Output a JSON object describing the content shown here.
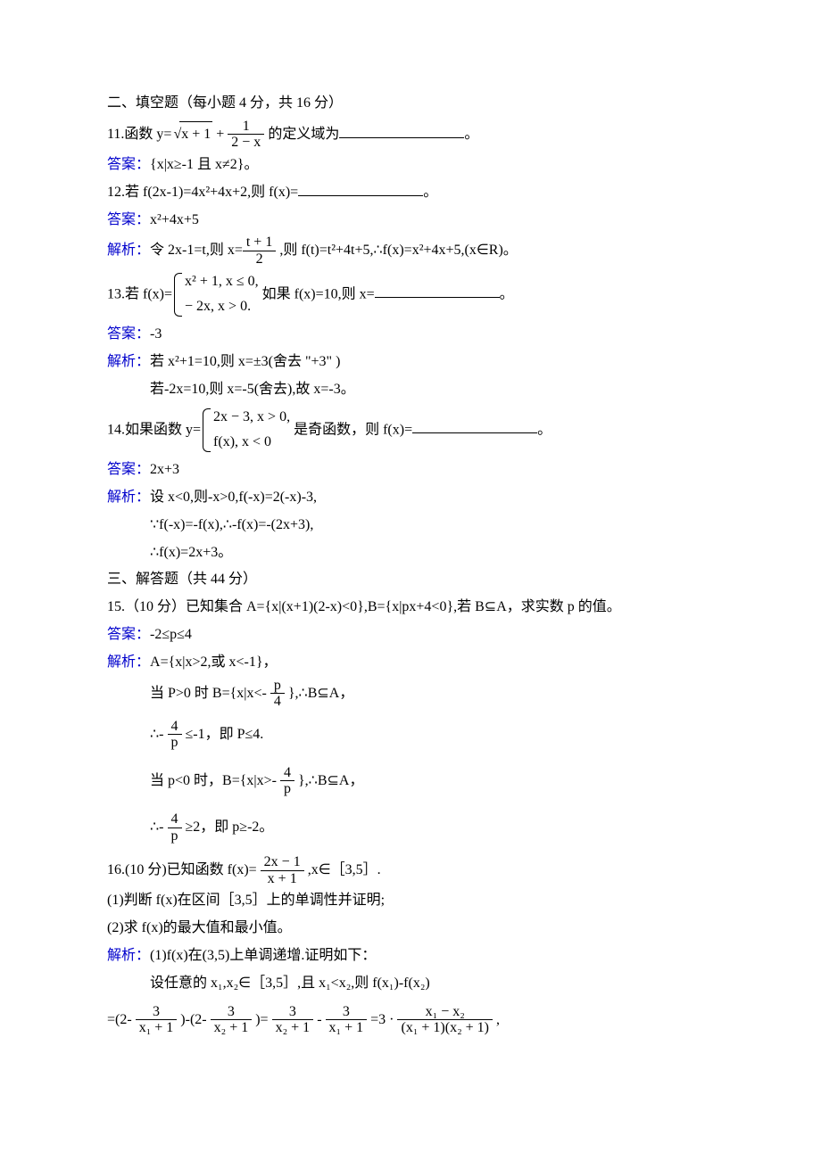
{
  "sec2": {
    "title": "二、填空题（每小题 4 分，共 16 分）"
  },
  "q11": {
    "pre": "11.函数 y=",
    "sqrt_rad": "x + 1",
    "plus": " + ",
    "frac_num": "1",
    "frac_den": "2 − x",
    "post": " 的定义域为",
    "end": "。",
    "ans_label": "答案：",
    "ans": "{x|x≥-1 且 x≠2}。"
  },
  "q12": {
    "text": "12.若 f(2x-1)=4x²+4x+2,则 f(x)=",
    "end": "。",
    "ans_label": "答案：",
    "ans": "x²+4x+5",
    "exp_label": "解析：",
    "exp_pre": "令 2x-1=t,则 x=",
    "frac_num": "t + 1",
    "frac_den": "2",
    "exp_post": " ,则 f(t)=t²+4t+5,∴f(x)=x²+4x+5,(x∈R)。"
  },
  "q13": {
    "pre": "13.若 f(x)=",
    "row1": "x² + 1,     x ≤ 0,",
    "row2": "− 2x,        x > 0.",
    "mid": " 如果 f(x)=10,则 x=",
    "end": "。",
    "ans_label": "答案：",
    "ans": "-3",
    "exp_label": "解析：",
    "exp1": "若 x²+1=10,则 x=±3(舍去 \"+3\" )",
    "exp2": "若-2x=10,则 x=-5(舍去),故 x=-3。"
  },
  "q14": {
    "pre": "14.如果函数 y=",
    "row1": "2x − 3,   x > 0,",
    "row2": "f(x),      x < 0",
    "mid": " 是奇函数，则 f(x)=",
    "end": "。",
    "ans_label": "答案：",
    "ans": "2x+3",
    "exp_label": "解析：",
    "exp1": "设 x<0,则-x>0,f(-x)=2(-x)-3,",
    "exp2": "∵f(-x)=-f(x),∴-f(x)=-(2x+3),",
    "exp3": "∴f(x)=2x+3。"
  },
  "sec3": {
    "title": "三、解答题（共 44 分）"
  },
  "q15": {
    "text": "15.（10 分）已知集合 A={x|(x+1)(2-x)<0},B={x|px+4<0},若 B⊆A，求实数 p 的值。",
    "ans_label": "答案：",
    "ans": "-2≤p≤4",
    "exp_label": "解析：",
    "exp1": "A={x|x>2,或 x<-1}，",
    "l1_pre": "当 P>0 时 B={x|x<- ",
    "l1_frac_num": "p",
    "l1_frac_den": "4",
    "l1_post": " },∴B⊆A，",
    "l2_pre": "∴- ",
    "l2_frac_num": "4",
    "l2_frac_den": "p",
    "l2_post": " ≤-1，即 P≤4.",
    "l3_pre": "当 p<0 时，B={x|x>- ",
    "l3_frac_num": "4",
    "l3_frac_den": "p",
    "l3_post": " },∴B⊆A，",
    "l4_pre": "∴- ",
    "l4_frac_num": "4",
    "l4_frac_den": "p",
    "l4_post": " ≥2，即 p≥-2。"
  },
  "q16": {
    "pre": "16.(10 分)已知函数 f(x)= ",
    "frac_num": "2x − 1",
    "frac_den": "x + 1",
    "post": " ,x∈［3,5］.",
    "p1": "(1)判断 f(x)在区间［3,5］上的单调性并证明;",
    "p2": "(2)求 f(x)的最大值和最小值。",
    "exp_label": "解析：",
    "exp1": "(1)f(x)在(3,5)上单调递增.证明如下：",
    "exp2": "设任意的 x₁,x₂∈［3,5］,且 x₁<x₂,则 f(x₁)-f(x₂)",
    "eq_pre": "=(2- ",
    "t1_num": "3",
    "t1_den": "x₁ + 1",
    "mid1": " )-(2- ",
    "t2_num": "3",
    "t2_den": "x₂ + 1",
    "mid2": " )= ",
    "t3_num": "3",
    "t3_den": "x₂ + 1",
    "mid3": " - ",
    "t4_num": "3",
    "t4_den": "x₁ + 1",
    "mid4": " =3 · ",
    "t5_num": "x₁ − x₂",
    "t5_den": "(x₁ + 1)(x₂ + 1)",
    "eq_end": " ,"
  }
}
